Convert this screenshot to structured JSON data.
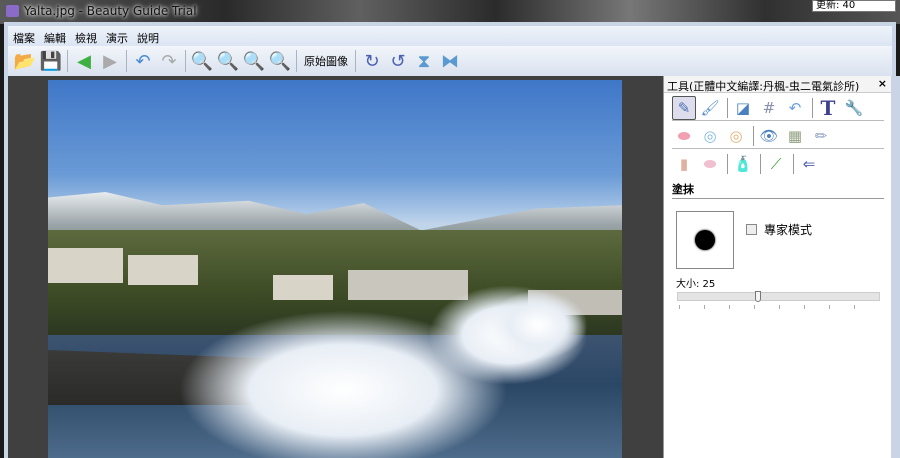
{
  "window": {
    "title": "Yalta.jpg - Beauty Guide Trial",
    "update_label": "更新: 40"
  },
  "menu": [
    "檔案",
    "編輯",
    "檢視",
    "演示",
    "說明"
  ],
  "toolbar": {
    "original_image_label": "原始圖像"
  },
  "panel": {
    "title": "工具(正體中文編譯:丹楓-虫二電氣診所)",
    "close": "×",
    "section": "塗抹",
    "expert_mode": "專家模式",
    "size_label": "大小: 25",
    "size_value": 25,
    "size_max": 100
  }
}
